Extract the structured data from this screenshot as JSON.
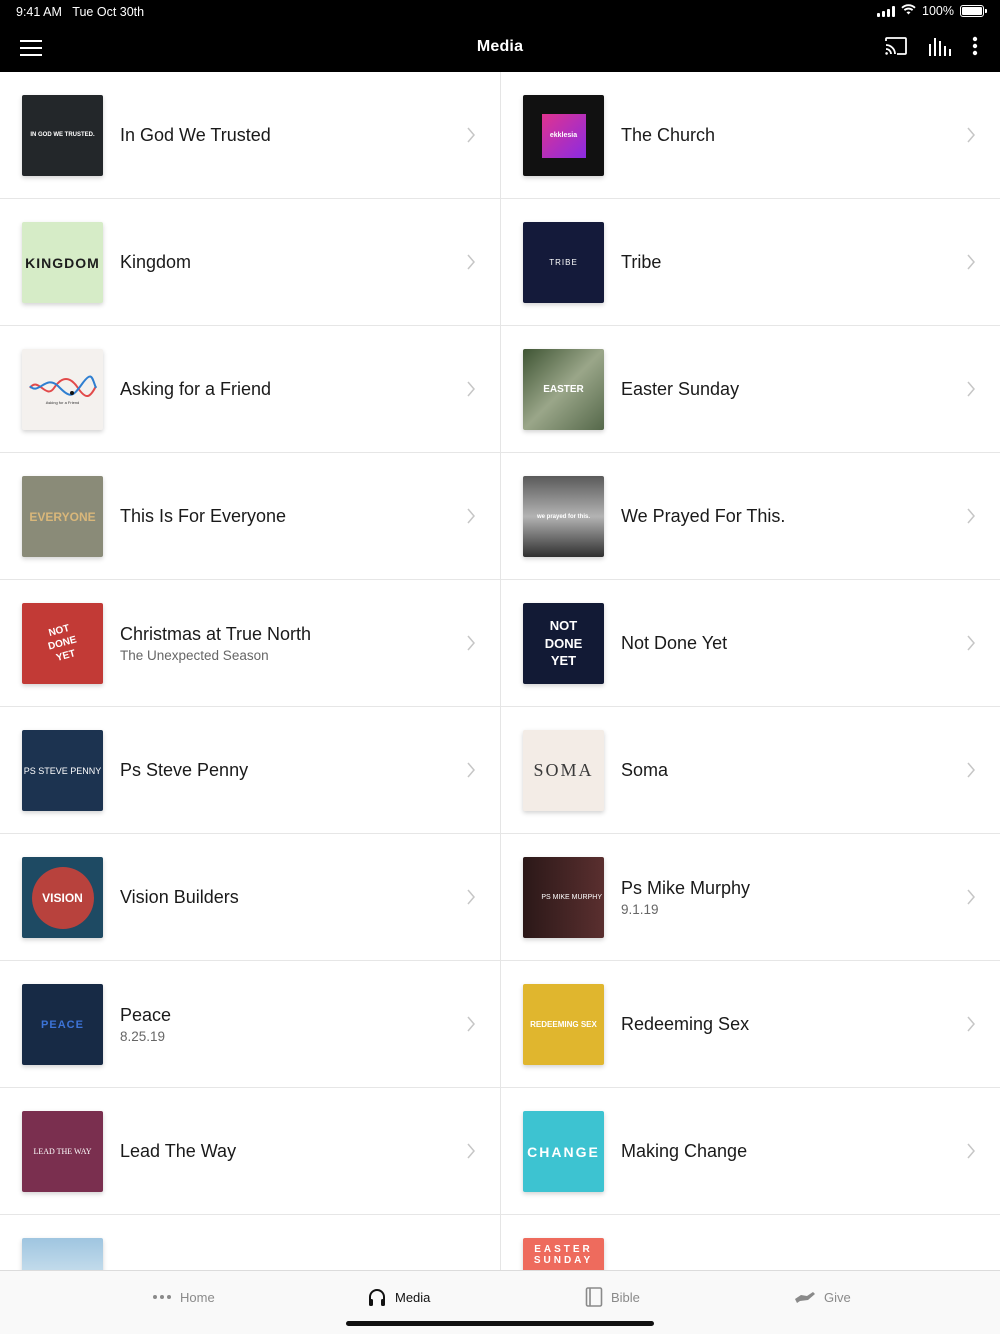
{
  "status": {
    "time": "9:41 AM",
    "date": "Tue Oct 30th",
    "battery": "100%"
  },
  "nav": {
    "title": "Media",
    "icons": [
      "menu-icon",
      "cast-icon",
      "audio-bars-icon",
      "more-vertical-icon"
    ]
  },
  "left_items": [
    {
      "title": "In God We Trusted",
      "subtitle": "",
      "thumb_text": "IN GOD WE TRUSTED."
    },
    {
      "title": "Kingdom",
      "subtitle": "",
      "thumb_text": "KINGDOM"
    },
    {
      "title": "Asking for a Friend",
      "subtitle": "",
      "thumb_text": "Asking for a Friend"
    },
    {
      "title": "This Is For Everyone",
      "subtitle": "",
      "thumb_text": "EVERYONE"
    },
    {
      "title": "Christmas at True North",
      "subtitle": "The Unexpected Season",
      "thumb_text": "NOT DONE YET"
    },
    {
      "title": "Ps Steve Penny",
      "subtitle": "",
      "thumb_text": "PS STEVE PENNY"
    },
    {
      "title": "Vision Builders",
      "subtitle": "",
      "thumb_text": "VISION"
    },
    {
      "title": "Peace",
      "subtitle": "8.25.19",
      "thumb_text": "PEACE"
    },
    {
      "title": "Lead The Way",
      "subtitle": "",
      "thumb_text": "LEAD THE WAY"
    }
  ],
  "right_items": [
    {
      "title": "The Church",
      "subtitle": "",
      "thumb_text": "ekklesia"
    },
    {
      "title": "Tribe",
      "subtitle": "",
      "thumb_text": "TRIBE"
    },
    {
      "title": "Easter Sunday",
      "subtitle": "",
      "thumb_text": "EASTER"
    },
    {
      "title": "We Prayed For This.",
      "subtitle": "",
      "thumb_text": "we prayed for this."
    },
    {
      "title": "Not Done Yet",
      "subtitle": "",
      "thumb_text": "NOT DONE YET"
    },
    {
      "title": "Soma",
      "subtitle": "",
      "thumb_text": "SOMA"
    },
    {
      "title": "Ps Mike Murphy",
      "subtitle": "9.1.19",
      "thumb_text": "PS MIKE MURPHY"
    },
    {
      "title": "Redeeming Sex",
      "subtitle": "",
      "thumb_text": "REDEEMING SEX"
    },
    {
      "title": "Making Change",
      "subtitle": "",
      "thumb_text": "CHANGE"
    }
  ],
  "partial": {
    "right_thumb_text": "EASTER SUNDAY"
  },
  "tabs": [
    {
      "label": "Home",
      "icon": "more-dots-icon"
    },
    {
      "label": "Media",
      "icon": "headphones-icon"
    },
    {
      "label": "Bible",
      "icon": "book-icon"
    },
    {
      "label": "Give",
      "icon": "hands-icon"
    }
  ]
}
